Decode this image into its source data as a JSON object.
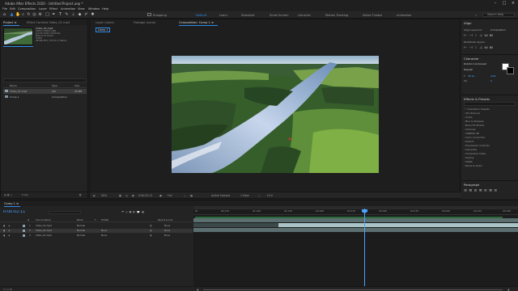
{
  "app": {
    "title": "Adobe After Effects 2020 - Untitled Project.aep *",
    "menu": [
      "File",
      "Edit",
      "Composition",
      "Layer",
      "Effect",
      "Animation",
      "View",
      "Window",
      "Help"
    ]
  },
  "toolbar": {
    "tools": [
      "home-icon",
      "selection-tool-icon",
      "hand-tool-icon",
      "zoom-tool-icon",
      "rotate-tool-icon",
      "camera-orbit-icon",
      "pan-behind-icon",
      "rectangle-tool-icon",
      "pen-tool-icon",
      "type-tool-icon",
      "brush-tool-icon",
      "clone-stamp-icon",
      "eraser-tool-icon",
      "roto-brush-icon",
      "puppet-pin-icon"
    ],
    "snapping_label": "Snapping",
    "workspaces": [
      "Default",
      "Learn",
      "Standard",
      "Small Screen",
      "Libraries",
      "Motion Tracking",
      "Sobre Fluidos",
      "Animation"
    ],
    "active_workspace": "Default",
    "search_placeholder": "Search Help"
  },
  "project_panel": {
    "tab_label": "Project ≡",
    "effect_controls_tab": "Effect Controls Video_01.mp4",
    "selected_item": "Video_01.mp4",
    "info_lines": [
      "1920 x 1080 (1.00)",
      "Δ 0:00:10:00, 30.00 fps",
      "Millions of Colors",
      "H.264",
      "48.000 kHz / 32 bit U / Stereo"
    ],
    "columns": [
      "Name",
      "Type",
      "Size"
    ],
    "items": [
      {
        "name": "Video_01.mp4",
        "type": "AVI",
        "size": "28 MB"
      },
      {
        "name": "Comp 1",
        "type": "Composition",
        "size": ""
      }
    ],
    "bpc": "8 bpc"
  },
  "composition_panel": {
    "tabs": [
      "Layer (none)",
      "Footage (none)",
      "Composition: Comp 1 ≡"
    ],
    "sub_tab": "Comp 1",
    "zoom": "50%",
    "timecode": "0:00:02:11",
    "resolution": "Full",
    "camera": "Active Camera",
    "views": "1 View"
  },
  "right_panels": {
    "align": {
      "title": "Align",
      "align_layers_to": "Align Layers to:",
      "target": "Composition",
      "distribute": "Distribute Layers:"
    },
    "character": {
      "title": "Character",
      "font": "Roboto Condensed",
      "style": "Regular",
      "size": "36 px",
      "leading": "Auto",
      "tracking": "0"
    },
    "effects": {
      "title": "Effects & Presets",
      "search_placeholder": "",
      "items": [
        "* Animation Presets",
        "3D Channel",
        "Audio",
        "Blur & Sharpen",
        "Boris FX Mocha",
        "Channel",
        "CINEMA 4D",
        "Color Correction",
        "Distort",
        "Expression Controls",
        "Generate",
        "Immersive Video",
        "Keying",
        "Matte",
        "Noise & Grain"
      ]
    },
    "paragraph": {
      "title": "Paragraph"
    }
  },
  "timeline": {
    "tab": "Comp 1 ≡",
    "timecode": "0:00:02:11",
    "columns": [
      "#",
      "Source Name",
      "Mode",
      "T",
      "TrkMat",
      "Parent & Link"
    ],
    "layers": [
      {
        "num": "1",
        "name": "Video_01.mp4",
        "mode": "Normal",
        "trkmat": "",
        "parent": "None"
      },
      {
        "num": "2",
        "name": "Video_01.mp4",
        "mode": "Normal",
        "trkmat": "None",
        "parent": "None"
      },
      {
        "num": "3",
        "name": "Video_01.mp4",
        "mode": "Normal",
        "trkmat": "None",
        "parent": "None"
      }
    ],
    "ruler_labels": [
      "0f",
      "00:15f",
      "01:00f",
      "01:15f",
      "02:00f",
      "02:15f",
      "03:00f",
      "03:15f",
      "04:00f",
      "04:15f",
      "05:00f"
    ]
  },
  "colors": {
    "accent": "#2d8ceb",
    "playhead": "#4aa3ff",
    "layer_bar": "#5b6e70",
    "layer_bar_sel": "#a9c3c6"
  }
}
